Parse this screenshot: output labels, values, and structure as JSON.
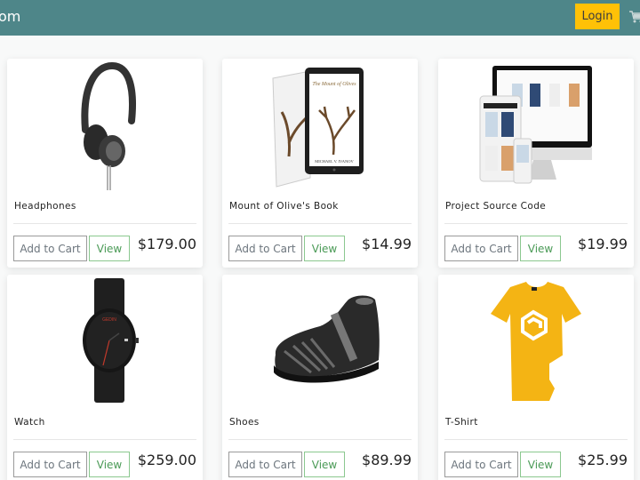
{
  "navbar": {
    "brand": "om",
    "login_label": "Login",
    "cart_icon": "shopping-cart-icon",
    "colors": {
      "background": "#4e8689",
      "login": "#ffc107"
    }
  },
  "products": [
    {
      "name": "Headphones",
      "price": "$179.00",
      "add_label": "Add to Cart",
      "view_label": "View",
      "image": "headphones-image"
    },
    {
      "name": "Mount of Olive's Book",
      "price": "$14.99",
      "add_label": "Add to Cart",
      "view_label": "View",
      "image": "book-image"
    },
    {
      "name": "Project Source Code",
      "price": "$19.99",
      "add_label": "Add to Cart",
      "view_label": "View",
      "image": "devices-image"
    },
    {
      "name": "Watch",
      "price": "$259.00",
      "add_label": "Add to Cart",
      "view_label": "View",
      "image": "watch-image"
    },
    {
      "name": "Shoes",
      "price": "$89.99",
      "add_label": "Add to Cart",
      "view_label": "View",
      "image": "shoes-image"
    },
    {
      "name": "T-Shirt",
      "price": "$25.99",
      "add_label": "Add to Cart",
      "view_label": "View",
      "image": "tshirt-image"
    }
  ]
}
